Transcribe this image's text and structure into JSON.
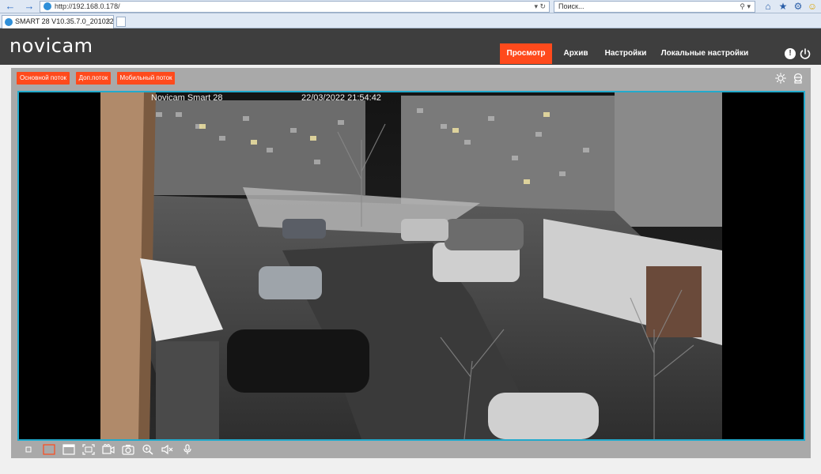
{
  "browser": {
    "url": "http://192.168.0.178/",
    "search_placeholder": "Поиск...",
    "tab_title": "SMART 28 V10.35.7.0_201022"
  },
  "header": {
    "logo_text": "novicam",
    "tabs": [
      {
        "label": "Просмотр",
        "active": true
      },
      {
        "label": "Архив",
        "active": false
      },
      {
        "label": "Настройки",
        "active": false
      },
      {
        "label": "Локальные настройки",
        "active": false
      }
    ],
    "info_symbol": "!"
  },
  "streams": {
    "main_label": "Основной поток",
    "sub_label": "Доп.поток",
    "mobile_label": "Мобильный поток"
  },
  "video": {
    "osd_name": "Novicam Smart 28",
    "osd_time": "22/03/2022 21:54:42"
  },
  "toolbar": {
    "icons": [
      "window-1x1-icon",
      "window-fit-icon",
      "window-full-icon",
      "fullscreen-icon",
      "record-icon",
      "snapshot-icon",
      "digital-zoom-icon",
      "audio-mute-icon",
      "microphone-icon"
    ]
  },
  "colors": {
    "accent": "#ff4a1c",
    "header_bg": "#3e3e3e",
    "content_bg": "#a9a9a9",
    "video_border": "#22aacc"
  }
}
